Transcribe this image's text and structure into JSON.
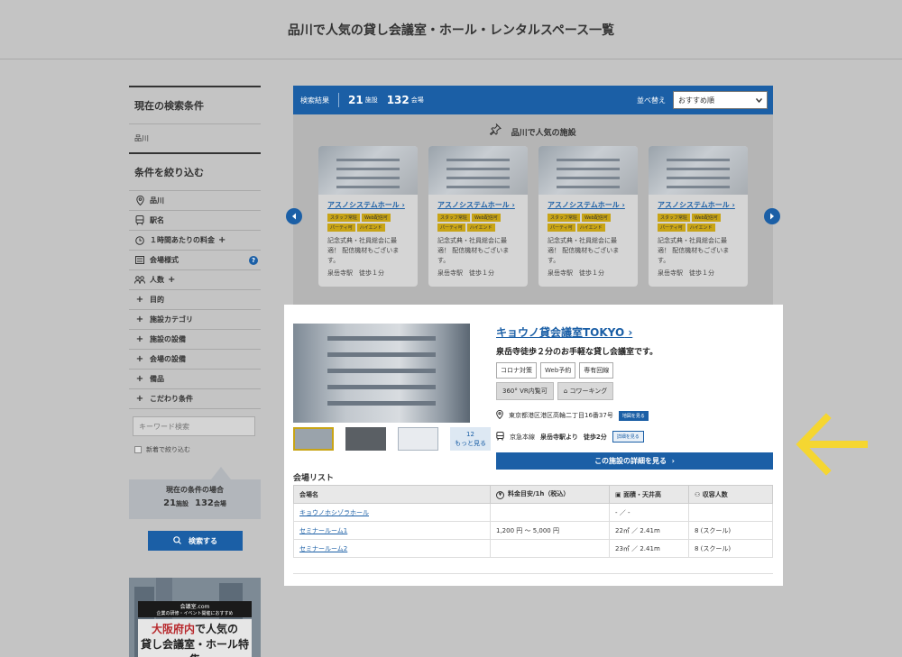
{
  "page_title": "品川で人気の貸し会議室・ホール・レンタルスペース一覧",
  "sidebar": {
    "current_head": "現在の検索条件",
    "current_value": "品川",
    "filter_head": "条件を絞り込む",
    "rows": [
      {
        "label": "品川",
        "icon": "map-pin"
      },
      {
        "label": "駅名",
        "icon": "train"
      },
      {
        "label": "１時間あたりの料金",
        "icon": "clock",
        "plus": true
      },
      {
        "label": "会場様式",
        "icon": "layout",
        "help": true
      },
      {
        "label": "人数",
        "icon": "people",
        "plus": true
      },
      {
        "label": "目的",
        "icon": "plus"
      },
      {
        "label": "施設カテゴリ",
        "icon": "plus"
      },
      {
        "label": "施設の設備",
        "icon": "plus"
      },
      {
        "label": "会場の設備",
        "icon": "plus"
      },
      {
        "label": "備品",
        "icon": "plus"
      },
      {
        "label": "こだわり条件",
        "icon": "plus"
      }
    ],
    "keyword_placeholder": "キーワード検索",
    "new_check_label": "新着で絞り込む",
    "status_label": "現在の条件の場合",
    "status_facilities": "21",
    "status_facilities_unit": "施設",
    "status_venues": "132",
    "status_venues_unit": "会場",
    "search_button": "検索する",
    "banner": {
      "logo": "会議室.com",
      "sub": "企業の研修・イベント開催におすすめ",
      "line1_red": "大阪府内",
      "line1_rest": "で人気の",
      "line2": "貸し会議室・ホール特集"
    }
  },
  "results": {
    "label": "検索結果",
    "facilities": "21",
    "facilities_unit": "施設",
    "venues": "132",
    "venues_unit": "会場",
    "sort_label": "並べ替え",
    "sort_value": "おすすめ順"
  },
  "popular": {
    "title": "品川で人気の施設",
    "cards": [
      {
        "name": "アスノシステムホール",
        "tags": [
          "スタッフ常駐",
          "Web配信可",
          "パーティ可",
          "ハイエンド"
        ],
        "desc": "記念式典・社員総会に最適！ 配信機材もございます。",
        "station": "泉岳寺駅　徒歩１分"
      },
      {
        "name": "アスノシステムホール",
        "tags": [
          "スタッフ常駐",
          "Web配信可",
          "パーティ可",
          "ハイエンド"
        ],
        "desc": "記念式典・社員総会に最適！ 配信機材もございます。",
        "station": "泉岳寺駅　徒歩１分"
      },
      {
        "name": "アスノシステムホール",
        "tags": [
          "スタッフ常駐",
          "Web配信可",
          "パーティ可",
          "ハイエンド"
        ],
        "desc": "記念式典・社員総会に最適！ 配信機材もございます。",
        "station": "泉岳寺駅　徒歩１分"
      },
      {
        "name": "アスノシステムホール",
        "tags": [
          "スタッフ常駐",
          "Web配信可",
          "パーティ可",
          "ハイエンド"
        ],
        "desc": "記念式典・社員総会に最適！ 配信機材もございます。",
        "station": "泉岳寺駅　徒歩１分"
      }
    ]
  },
  "venue": {
    "title": "キョウノ貸会議室TOKYO",
    "catch": "泉岳寺徒歩２分のお手軽な貸し会議室です。",
    "tags": [
      "コロナ対策",
      "Web予約",
      "専有回線"
    ],
    "tags2": [
      "VR内覧可",
      "コワーキング"
    ],
    "address": "東京都港区港区高輪二丁目16番37号",
    "map_button": "地図を見る",
    "line": "京急本線",
    "station": "泉岳寺駅より",
    "walk": "徒歩2分",
    "detail_small_button": "詳細を見る",
    "more_photos_count": "12",
    "more_photos_label": "もっと見る",
    "detail_button": "この施設の詳細を見る",
    "list_title": "会場リスト",
    "table": {
      "headers": [
        "会場名",
        "料金目安/1h（税込）",
        "面積・天井高",
        "収容人数"
      ],
      "rows": [
        {
          "name": "キョウノホシゾラホール",
          "price": "",
          "area": "- ／ -",
          "capacity": ""
        },
        {
          "name": "セミナールーム1",
          "price": "1,200 円 〜 5,000 円",
          "area": "22㎡ ／ 2.41m",
          "capacity": "8 (スクール)"
        },
        {
          "name": "セミナールーム2",
          "price": "",
          "area": "23㎡ ／ 2.41m",
          "capacity": "8 (スクール)"
        }
      ]
    }
  },
  "colors": {
    "primary_blue": "#1b5fa6",
    "tag_gold": "#c8a416",
    "arrow_yellow": "#f5d631"
  }
}
